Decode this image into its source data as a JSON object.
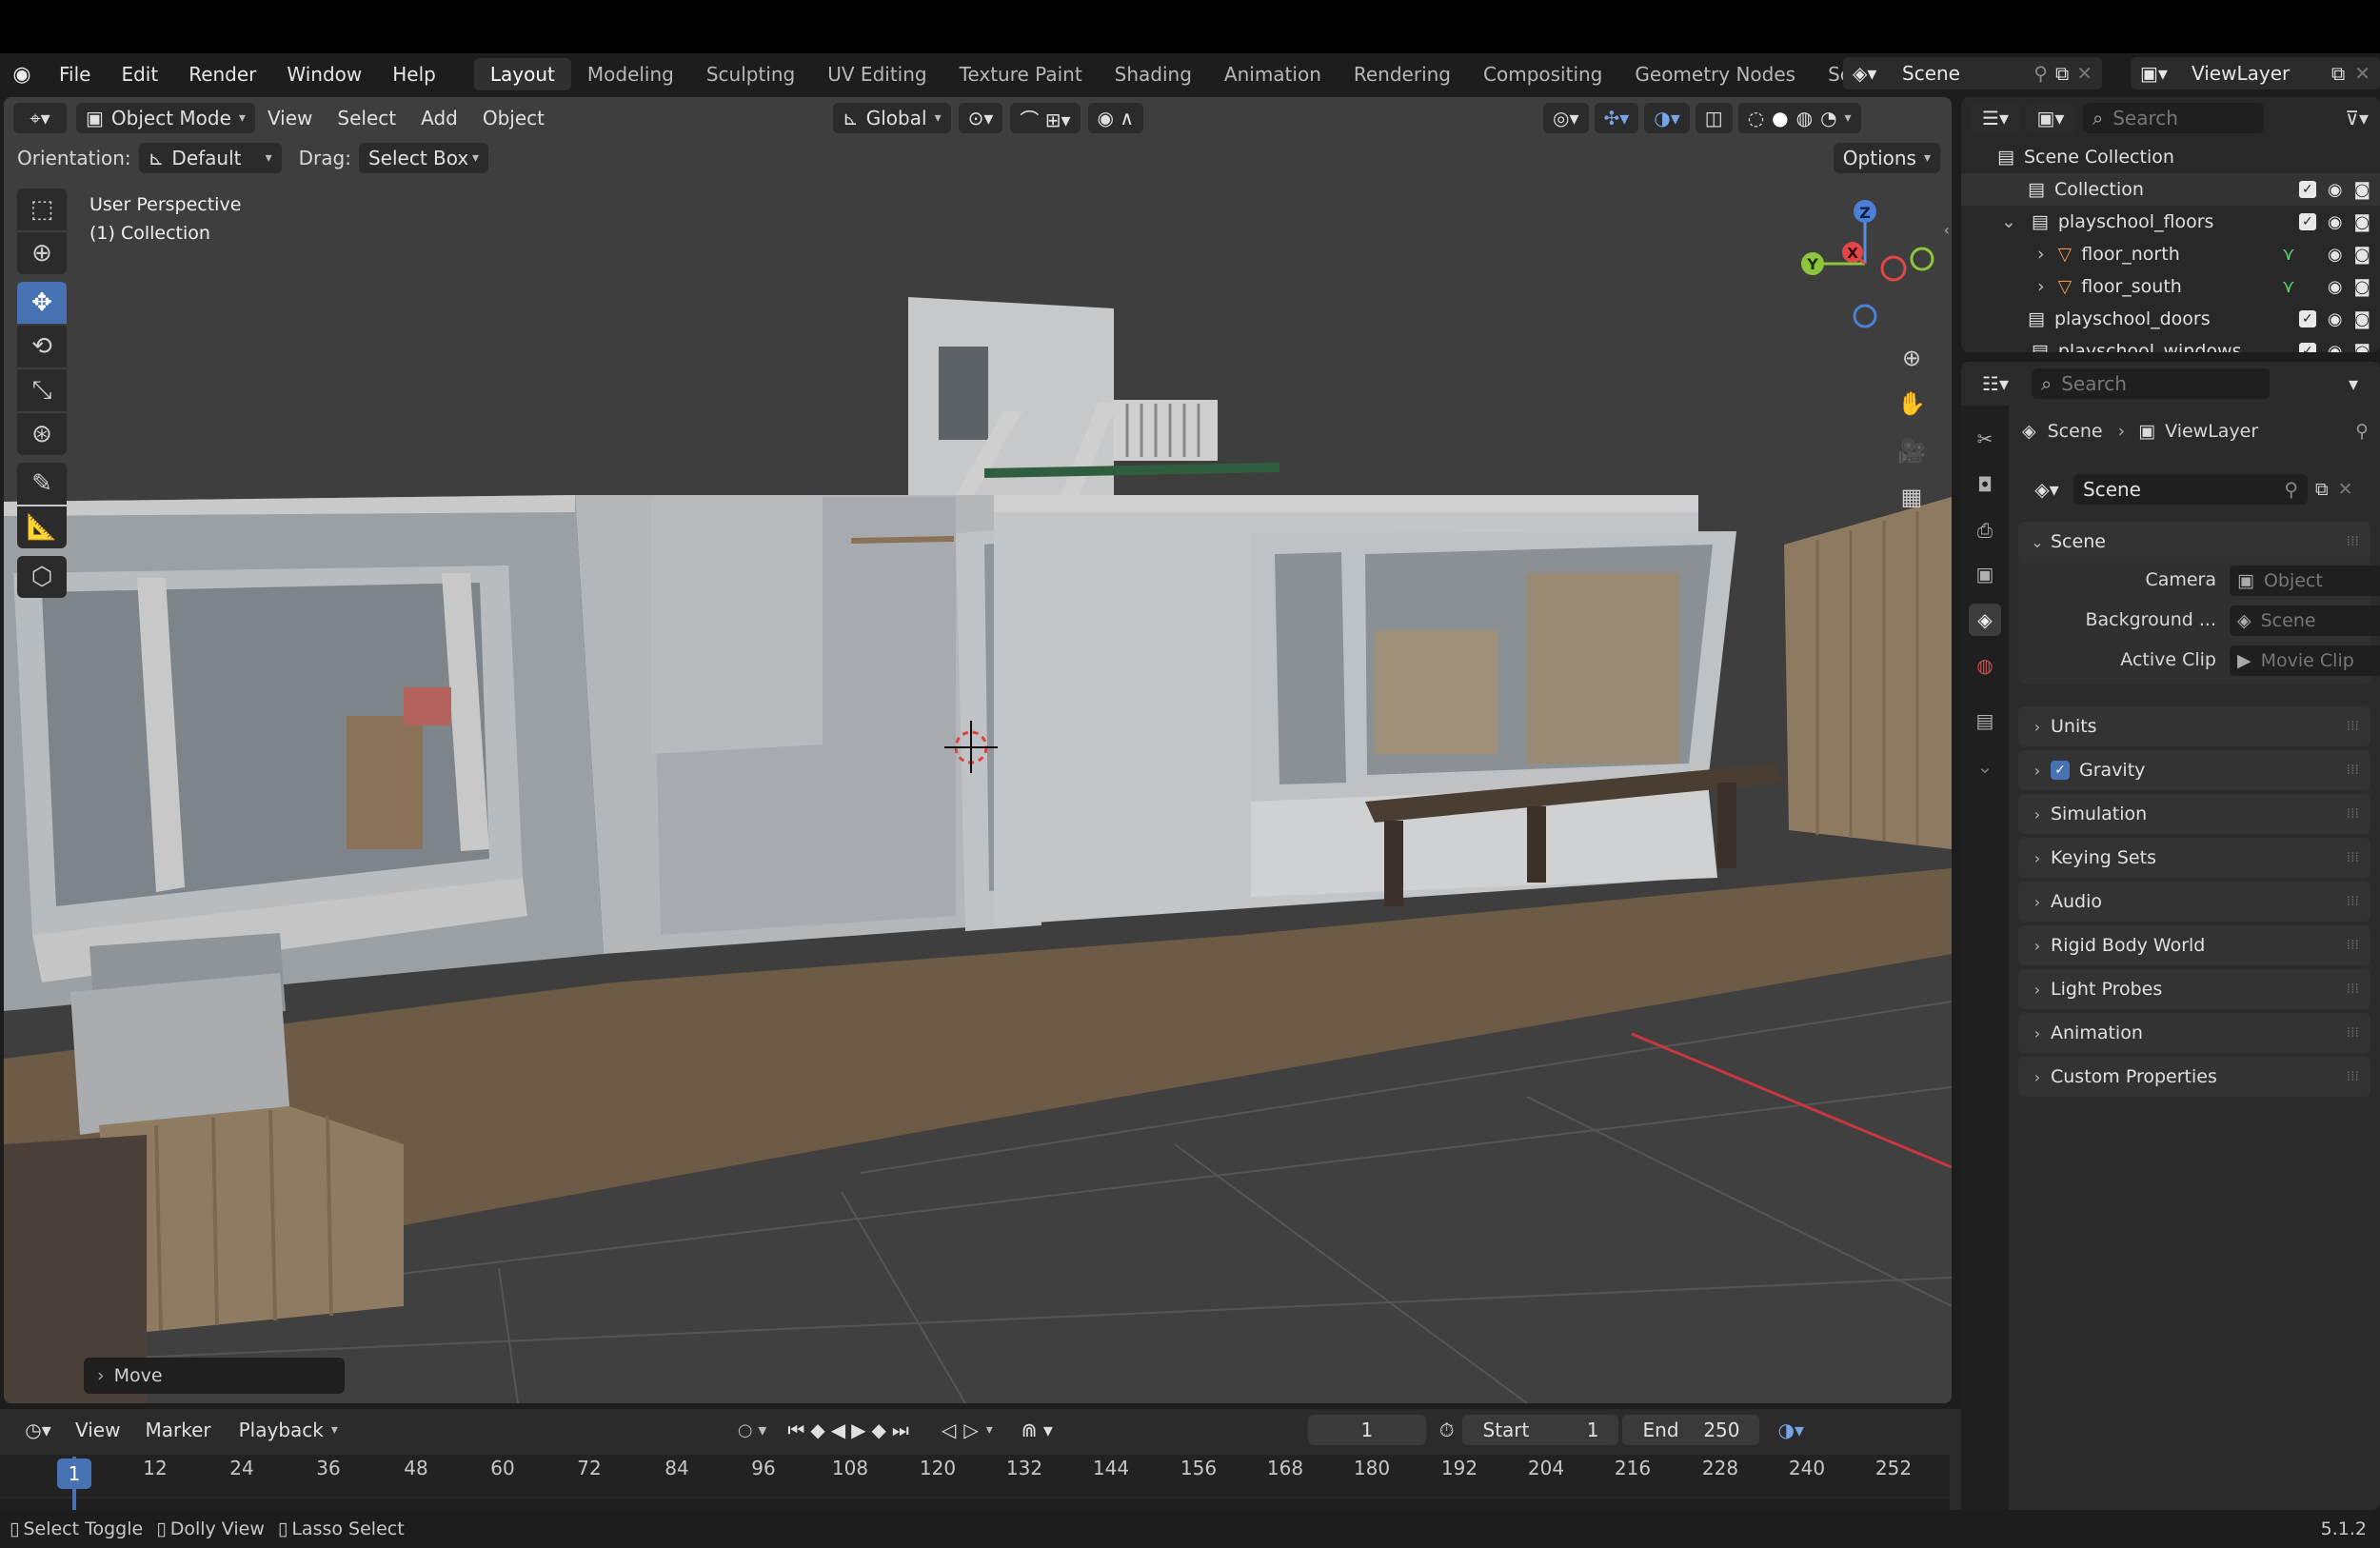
{
  "menu": {
    "file": "File",
    "edit": "Edit",
    "render": "Render",
    "window": "Window",
    "help": "Help"
  },
  "workspaces": [
    "Layout",
    "Modeling",
    "Sculpting",
    "UV Editing",
    "Texture Paint",
    "Shading",
    "Animation",
    "Rendering",
    "Compositing",
    "Geometry Nodes",
    "Scripting"
  ],
  "active_workspace": "Layout",
  "scene_name": "Scene",
  "view_layer_name": "ViewLayer",
  "viewport_header": {
    "mode": "Object Mode",
    "view": "View",
    "select": "Select",
    "add": "Add",
    "object": "Object",
    "transform_orientation": "Global"
  },
  "tool_settings": {
    "orientation_label": "Orientation:",
    "orientation_value": "Default",
    "drag_label": "Drag:",
    "drag_value": "Select Box",
    "options": "Options"
  },
  "viewport_overlay": {
    "perspective": "User Perspective",
    "collection": "(1) Collection",
    "last_operator": "Move"
  },
  "gizmo": {
    "z": "Z",
    "y": "Y",
    "x": "X"
  },
  "outliner": {
    "search_placeholder": "Search",
    "rows": [
      {
        "label": "Scene Collection",
        "indent": 0
      },
      {
        "label": "Collection",
        "indent": 1
      },
      {
        "label": "playschool_floors",
        "indent": 1
      },
      {
        "label": "floor_north",
        "indent": 2
      },
      {
        "label": "floor_south",
        "indent": 2
      },
      {
        "label": "playschool_doors",
        "indent": 1
      },
      {
        "label": "playschool_windows",
        "indent": 1
      }
    ]
  },
  "properties": {
    "search_placeholder": "Search",
    "breadcrumb_scene": "Scene",
    "breadcrumb_viewlayer": "ViewLayer",
    "datablock": "Scene",
    "scene_panel": "Scene",
    "camera_label": "Camera",
    "camera_placeholder": "Object",
    "background_label": "Background ...",
    "background_placeholder": "Scene",
    "active_clip_label": "Active Clip",
    "active_clip_placeholder": "Movie Clip",
    "panels": [
      "Units",
      "Gravity",
      "Simulation",
      "Keying Sets",
      "Audio",
      "Rigid Body World",
      "Light Probes",
      "Animation",
      "Custom Properties"
    ],
    "gravity_checked": true
  },
  "timeline": {
    "view": "View",
    "marker": "Marker",
    "playback": "Playback",
    "current_frame": "1",
    "start_label": "Start",
    "start_value": "1",
    "end_label": "End",
    "end_value": "250",
    "ticks": [
      "1",
      "12",
      "24",
      "36",
      "48",
      "60",
      "72",
      "84",
      "96",
      "108",
      "120",
      "132",
      "144",
      "156",
      "168",
      "180",
      "192",
      "204",
      "216",
      "228",
      "240",
      "252"
    ]
  },
  "statusbar": {
    "select_toggle": "Select Toggle",
    "dolly_view": "Dolly View",
    "lasso_select": "Lasso Select",
    "version": "5.1.2"
  },
  "colors": {
    "accent": "#4772b3",
    "floor": "#6e5b45",
    "grid_red_axis": "#c8373f"
  }
}
